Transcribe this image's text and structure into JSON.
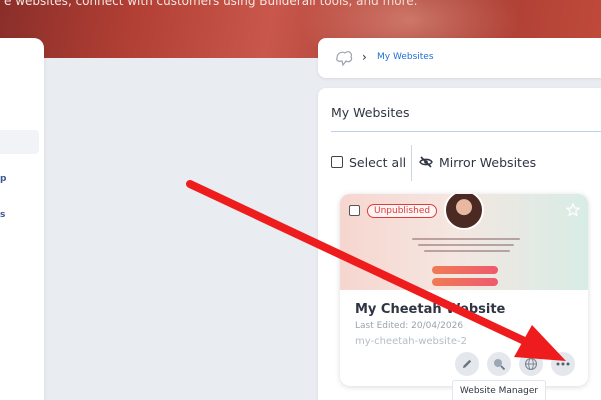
{
  "hero": {
    "text": "e websites, connect with customers using Builderall tools, and more."
  },
  "sidebar": {
    "fragments": [
      "p",
      "s"
    ]
  },
  "breadcrumb": {
    "separator": "›",
    "current": "My Websites"
  },
  "main": {
    "title": "My Websites",
    "select_all_label": "Select all",
    "mirror_label": "Mirror Websites"
  },
  "website": {
    "status_badge": "Unpublished",
    "name": "My Cheetah Website",
    "last_edited": "Last Edited: 20/04/2026",
    "slug": "my-cheetah-website-2",
    "actions": [
      "pencil-icon",
      "search-user-icon",
      "globe-icon",
      "more-icon"
    ]
  },
  "tooltip": {
    "text": "Website Manager"
  },
  "colors": {
    "accent_link": "#1f6fd1",
    "badge_red": "#e23a3a",
    "annotation_arrow": "#ee1c1c"
  }
}
